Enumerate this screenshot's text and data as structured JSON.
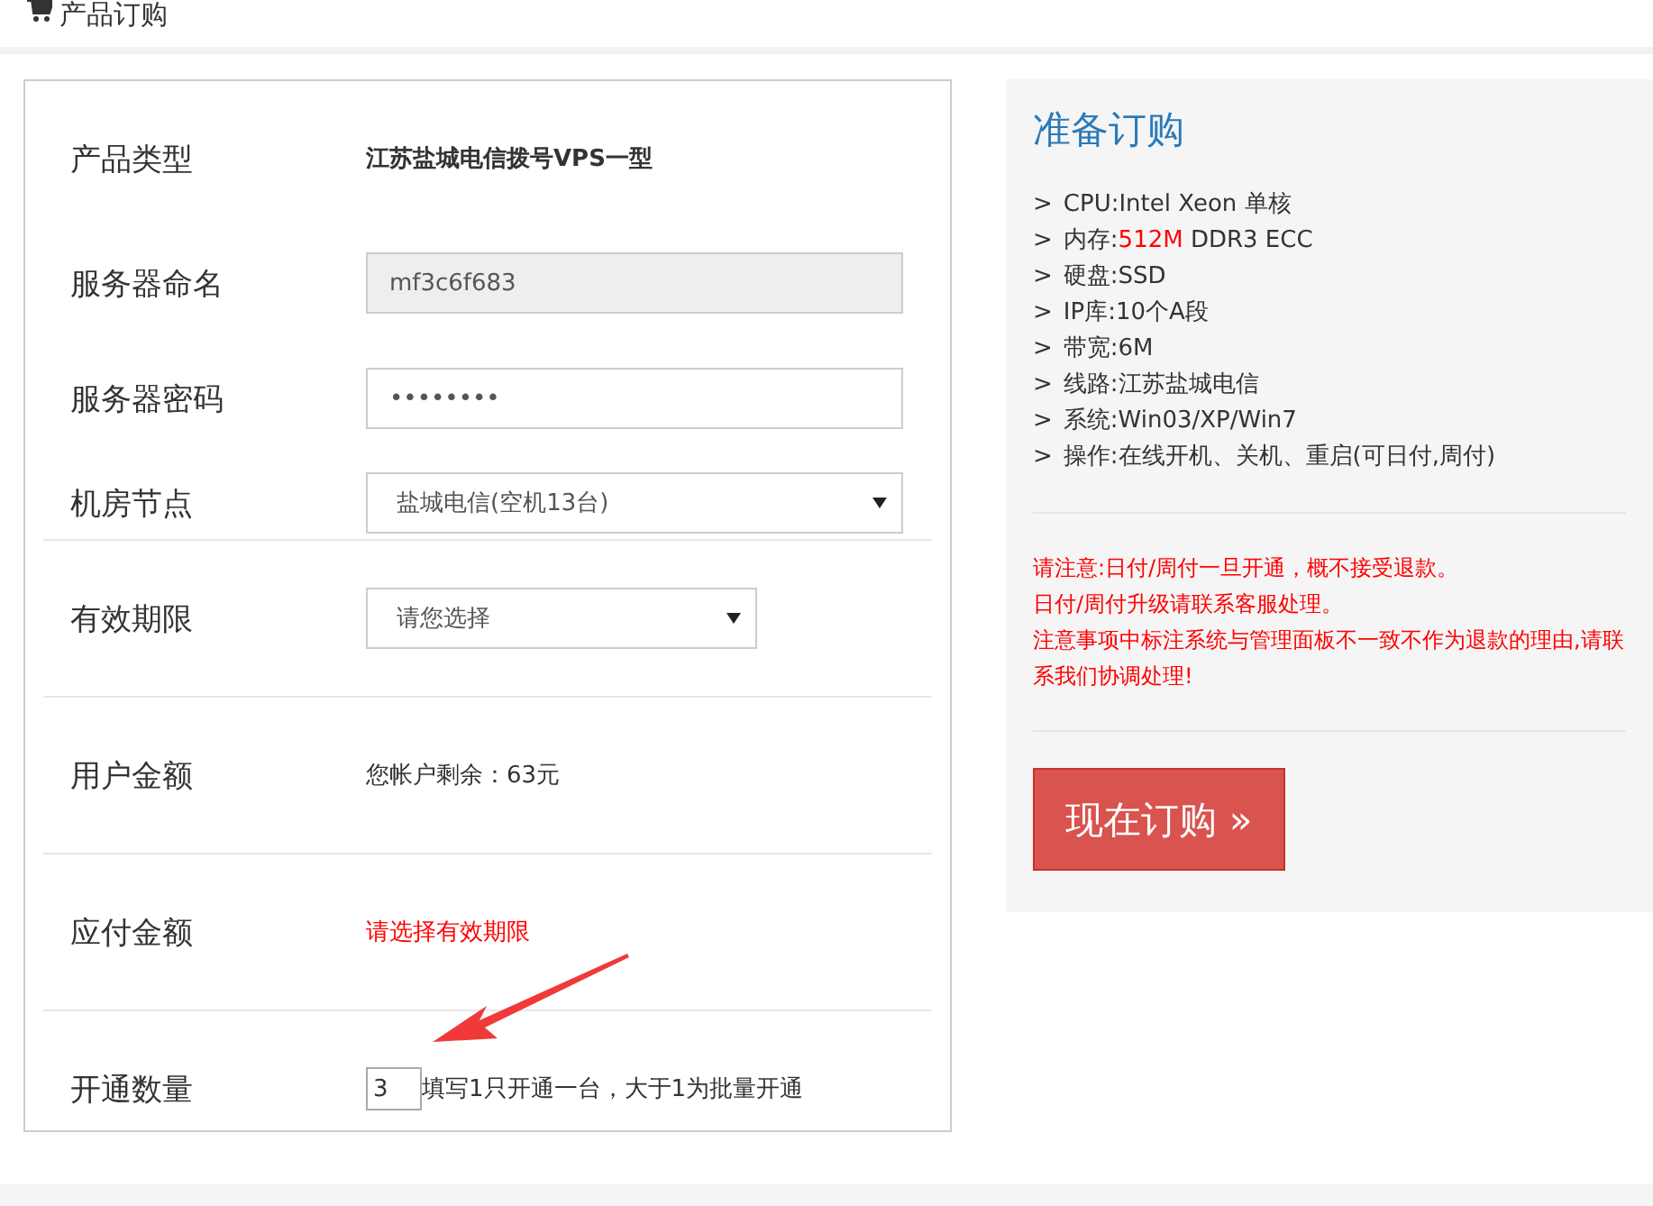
{
  "header": {
    "title": "产品订购"
  },
  "form": {
    "rows": [
      {
        "label": "产品类型",
        "kind": "text",
        "value": "江苏盐城电信拨号VPS一型"
      },
      {
        "label": "服务器命名",
        "kind": "input",
        "value": "mf3c6f683",
        "disabled": true
      },
      {
        "label": "服务器密码",
        "kind": "password",
        "value": "••••••••"
      },
      {
        "label": "机房节点",
        "kind": "select",
        "value": "盐城电信(空机13台)",
        "wide": true
      },
      {
        "label": "有效期限",
        "kind": "select",
        "value": "请您选择",
        "wide": false
      },
      {
        "label": "用户金额",
        "kind": "text",
        "value": "您帐户剩余：63元"
      },
      {
        "label": "应付金额",
        "kind": "warning",
        "value": "请选择有效期限"
      },
      {
        "label": "开通数量",
        "kind": "quantity",
        "value": "3",
        "hint": "填写1只开通一台，大于1为批量开通"
      }
    ]
  },
  "summary": {
    "title": "准备订购",
    "specs": [
      {
        "bullet": ">",
        "text": "CPU:Intel Xeon 单核"
      },
      {
        "bullet": ">",
        "text": "内存:",
        "highlight": "512M",
        "suffix": " DDR3 ECC"
      },
      {
        "bullet": ">",
        "text": "硬盘:SSD"
      },
      {
        "bullet": ">",
        "text": "IP库:10个A段"
      },
      {
        "bullet": ">",
        "text": "带宽:6M"
      },
      {
        "bullet": ">",
        "text": "线路:江苏盐城电信"
      },
      {
        "bullet": ">",
        "text": "系统:Win03/XP/Win7"
      },
      {
        "bullet": ">",
        "text": "操作:在线开机、关机、重启(可日付,周付)"
      }
    ],
    "notices": [
      "请注意:日付/周付一旦开通，概不接受退款。",
      "日付/周付升级请联系客服处理。",
      "注意事项中标注系统与管理面板不一致不作为退款的理由,请联系我们协调处理!"
    ],
    "button": "现在订购 »"
  }
}
